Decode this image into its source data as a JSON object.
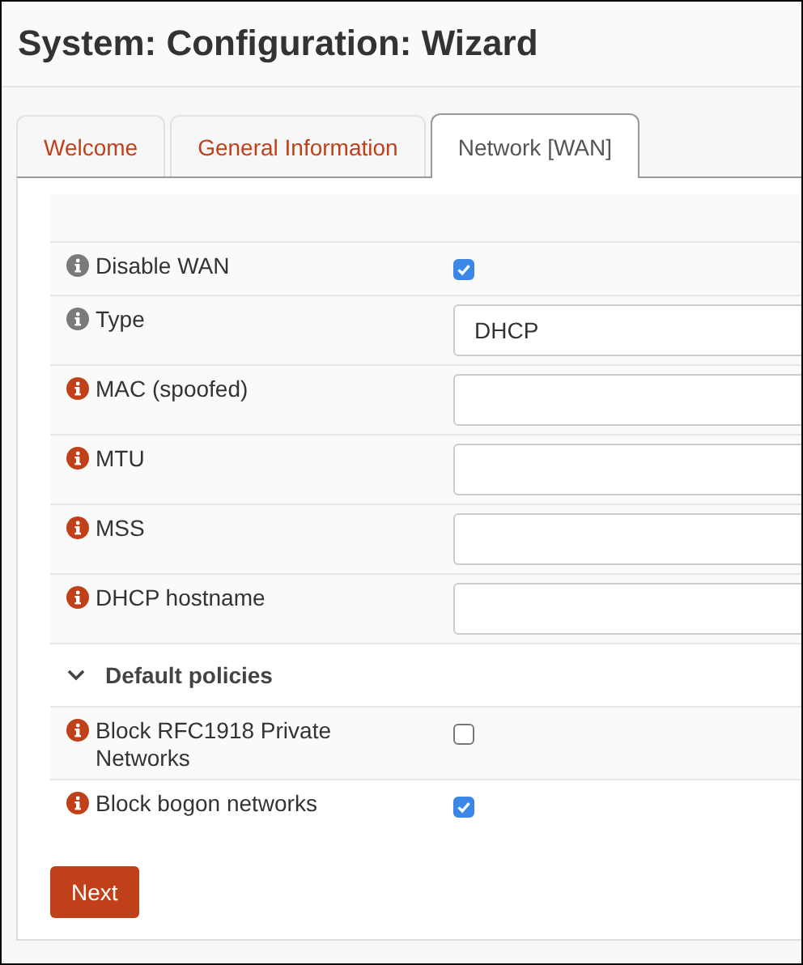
{
  "page_title": "System: Configuration: Wizard",
  "tabs": [
    {
      "label": "Welcome",
      "selected": false
    },
    {
      "label": "General Information",
      "selected": false
    },
    {
      "label": "Network [WAN]",
      "selected": true
    }
  ],
  "form": {
    "rows": [
      {
        "kind": "checkbox",
        "label": "Disable WAN",
        "color": "#7a7a7a",
        "checked": true
      },
      {
        "kind": "select",
        "label": "Type",
        "color": "#7a7a7a",
        "value": "DHCP"
      },
      {
        "kind": "text",
        "label": "MAC (spoofed)",
        "color": "#c0401a"
      },
      {
        "kind": "text",
        "label": "MTU",
        "color": "#c0401a"
      },
      {
        "kind": "text",
        "label": "MSS",
        "color": "#c0401a"
      },
      {
        "kind": "text",
        "label": "DHCP hostname",
        "color": "#c0401a"
      },
      {
        "kind": "section",
        "label": "Default policies",
        "expanded": true
      },
      {
        "kind": "checkbox",
        "label": "Block RFC1918 Private Networks",
        "color": "#c0401a",
        "checked": false
      },
      {
        "kind": "checkbox",
        "label": "Block bogon networks",
        "color": "#c0401a",
        "checked": true
      }
    ]
  },
  "buttons": [
    {
      "label": "Next"
    }
  ]
}
